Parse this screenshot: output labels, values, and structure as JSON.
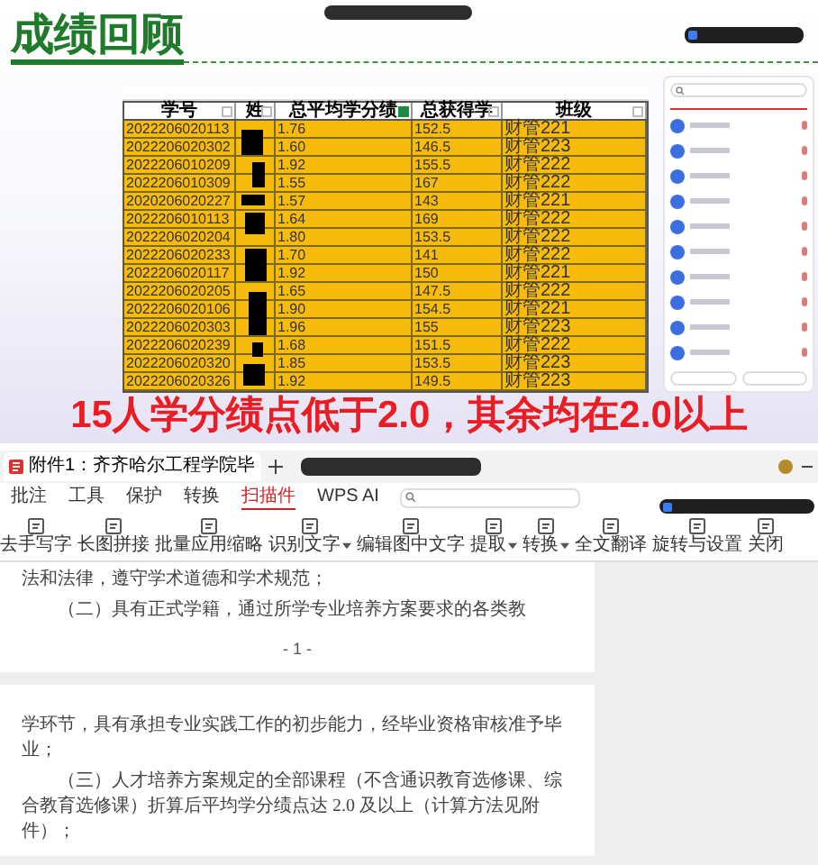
{
  "slide": {
    "title": "成绩回顾",
    "table": {
      "columns": [
        "学号",
        "姓",
        "总平均学分绩",
        "总获得学",
        "班级"
      ],
      "rows": [
        {
          "id": "2022206020113",
          "gpa": "1.76",
          "credits": "152.5",
          "class": "财管221"
        },
        {
          "id": "2022206020302",
          "gpa": "1.60",
          "credits": "146.5",
          "class": "财管223"
        },
        {
          "id": "2022206010209",
          "gpa": "1.92",
          "credits": "155.5",
          "class": "财管222"
        },
        {
          "id": "2022206010309",
          "gpa": "1.55",
          "credits": "167",
          "class": "财管222"
        },
        {
          "id": "2020206020227",
          "gpa": "1.57",
          "credits": "143",
          "class": "财管221"
        },
        {
          "id": "2022206010113",
          "gpa": "1.64",
          "credits": "169",
          "class": "财管222"
        },
        {
          "id": "2022206020204",
          "gpa": "1.80",
          "credits": "153.5",
          "class": "财管222"
        },
        {
          "id": "2022206020233",
          "gpa": "1.70",
          "credits": "141",
          "class": "财管222"
        },
        {
          "id": "2022206020117",
          "gpa": "1.92",
          "credits": "150",
          "class": "财管221"
        },
        {
          "id": "2022206020205",
          "gpa": "1.65",
          "credits": "147.5",
          "class": "财管222"
        },
        {
          "id": "2022206020106",
          "gpa": "1.90",
          "credits": "154.5",
          "class": "财管221"
        },
        {
          "id": "2022206020303",
          "gpa": "1.96",
          "credits": "155",
          "class": "财管223"
        },
        {
          "id": "2022206020239",
          "gpa": "1.68",
          "credits": "151.5",
          "class": "财管222"
        },
        {
          "id": "2022206020320",
          "gpa": "1.85",
          "credits": "153.5",
          "class": "财管223"
        },
        {
          "id": "2022206020326",
          "gpa": "1.92",
          "credits": "149.5",
          "class": "财管223"
        }
      ]
    },
    "caption": "15人学分绩点低于2.0，其余均在2.0以上"
  },
  "document_window": {
    "tab": {
      "title": "附件1：齐齐哈尔工程学院毕"
    },
    "menu": [
      {
        "label": "批注",
        "selected": false
      },
      {
        "label": "工具",
        "selected": false
      },
      {
        "label": "保护",
        "selected": false
      },
      {
        "label": "转换",
        "selected": false
      },
      {
        "label": "扫描件",
        "selected": true
      },
      {
        "label": "WPS AI",
        "selected": false
      }
    ],
    "toolbar": [
      {
        "label": "去手写字",
        "dropdown": false
      },
      {
        "label": "长图拼接",
        "dropdown": false
      },
      {
        "label": "批量应用缩略",
        "dropdown": false
      },
      {
        "label": "识别文字",
        "dropdown": true
      },
      {
        "label": "编辑图中文字",
        "dropdown": false
      },
      {
        "label": "提取",
        "dropdown": true
      },
      {
        "label": "转换",
        "dropdown": true
      },
      {
        "label": "全文翻译",
        "dropdown": false
      },
      {
        "label": "旋转与设置",
        "dropdown": false
      },
      {
        "label": "关闭",
        "dropdown": false
      }
    ],
    "pages": [
      {
        "paragraphs": [
          "法和法律，遵守学术道德和学术规范；",
          "（二）具有正式学籍，通过所学专业培养方案要求的各类教"
        ],
        "page_number": "- 1 -"
      },
      {
        "paragraphs": [
          "学环节，具有承担专业实践工作的初步能力，经毕业资格审核准予毕业；",
          "（三）人才培养方案规定的全部课程（不含通识教育选修课、综合教育选修课）折算后平均学分绩点达 2.0 及以上（计算方法见附件）；"
        ]
      }
    ]
  }
}
